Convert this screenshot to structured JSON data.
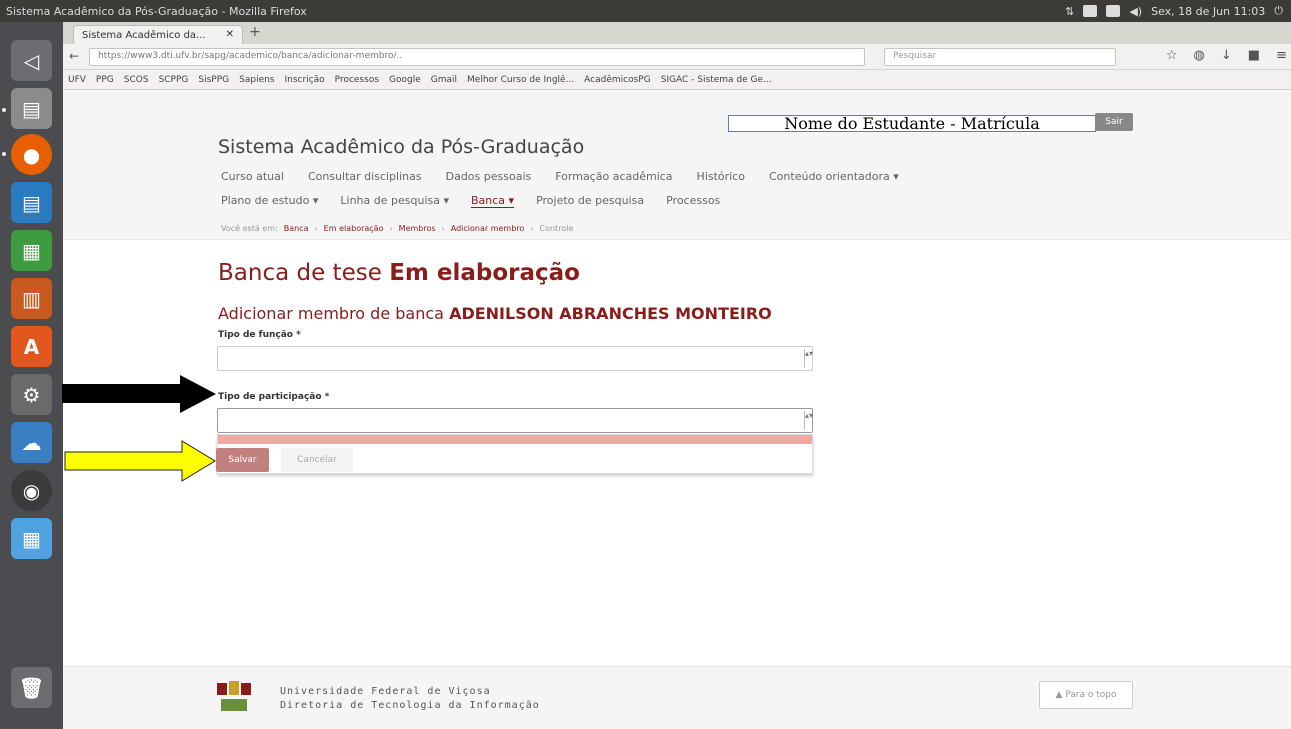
{
  "window": {
    "title": "Sistema Acadêmico da Pós-Graduação - Mozilla Firefox",
    "tray_time": "Sex, 18 de Jun 11:03"
  },
  "browser": {
    "tab_title": "Sistema Acadêmico da...",
    "url": "https://www3.dti.ufv.br/sapg/academico/banca/adicionar-membro/..",
    "search_placeholder": "Pesquisar",
    "bookmarks": [
      "UFV",
      "PPG",
      "SCOS",
      "SCPPG",
      "SisPPG",
      "Sapiens",
      "Inscrição",
      "Processos",
      "Google",
      "Gmail",
      "Melhor Curso de Inglê...",
      "AcadêmicosPG",
      "SIGAC - Sistema de Ge..."
    ]
  },
  "header": {
    "student_box": "Nome do Estudante - Matrícula",
    "exit_label": "Sair",
    "system_title": "Sistema Acadêmico da Pós-Graduação",
    "menu_row1": [
      "Curso atual",
      "Consultar disciplinas",
      "Dados pessoais",
      "Formação acadêmica",
      "Histórico",
      "Conteúdo orientadora ▾"
    ],
    "menu_row2": [
      "Plano de estudo ▾",
      "Linha de pesquisa ▾",
      "Banca ▾",
      "Projeto de pesquisa",
      "Processos"
    ],
    "breadcrumb": {
      "prefix": "Você está em:",
      "items": [
        "Banca",
        "Em elaboração",
        "Membros",
        "Adicionar membro",
        "Controle"
      ]
    }
  },
  "main": {
    "title_prefix": "Banca de tese",
    "title_bold": "Em elaboração",
    "subtitle_prefix": "Adicionar membro de banca",
    "subtitle_name": "ADENILSON ABRANCHES MONTEIRO",
    "field1_label": "Tipo de função *",
    "field1_value": "",
    "field2_label": "Tipo de participação *",
    "field2_value": "",
    "save_label": "Salvar",
    "cancel_label": "Cancelar"
  },
  "footer": {
    "line1": "Universidade Federal de Viçosa",
    "line2": "Diretoria de Tecnologia da Informação",
    "top_button": "▲ Para o topo"
  },
  "colors": {
    "brand": "#8a1c1c",
    "arrow_black": "#000000",
    "arrow_yellow": "#ffff00"
  }
}
